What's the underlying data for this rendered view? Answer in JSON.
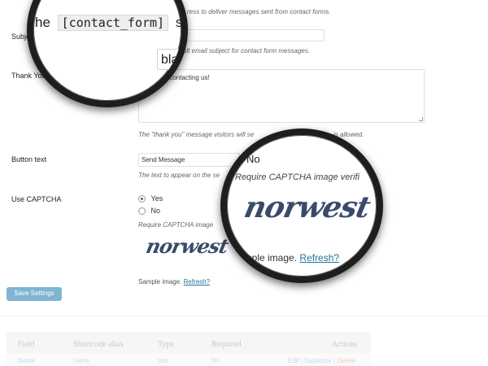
{
  "settings": {
    "email_desc": "ress to deliver messages sent from contact forms.",
    "subject_label": "Subje",
    "subject_desc": "ult email subject for contact form messages.",
    "thankyou_label": "Thank You",
    "thankyou_value": "or contacting us!",
    "thankyou_desc_a": "The \"thank you\" message visitors will se",
    "thankyou_desc_b": "is allowed.",
    "button_label": "Button text",
    "button_value": "Send Message",
    "button_desc": "The text to appear on the se",
    "captcha_label": "Use CAPTCHA",
    "captcha_yes": "Yes",
    "captcha_no": "No",
    "captcha_desc": "Require CAPTCHA image",
    "captcha_word": "norwest",
    "sample_text": "Sample image.",
    "refresh_link": "Refresh?",
    "save_button": "Save Settings"
  },
  "table": {
    "headers": [
      "Field",
      "Shortcode alias",
      "Type",
      "Required",
      "Actions"
    ],
    "row": {
      "field": "Name",
      "alias": "name",
      "type": "text",
      "required": "No",
      "edit": "Edit",
      "sep1": "|",
      "duplicate": "Duplicate",
      "sep2": "|",
      "delete": "Delete"
    }
  },
  "magnifier_top": {
    "prefix": "he",
    "code": "[contact_form]",
    "suffix": "sho",
    "partial": "bla"
  },
  "magnifier_bottom": {
    "no_label": "No",
    "desc": "Require CAPTCHA image verifi",
    "captcha_word": "norwest",
    "sample_text": "ample image.",
    "refresh_link": "Refresh?"
  },
  "colors": {
    "accent": "#21759b",
    "save_button": "#7fb4d3",
    "magnifier_rim": "#1e1e1e"
  }
}
